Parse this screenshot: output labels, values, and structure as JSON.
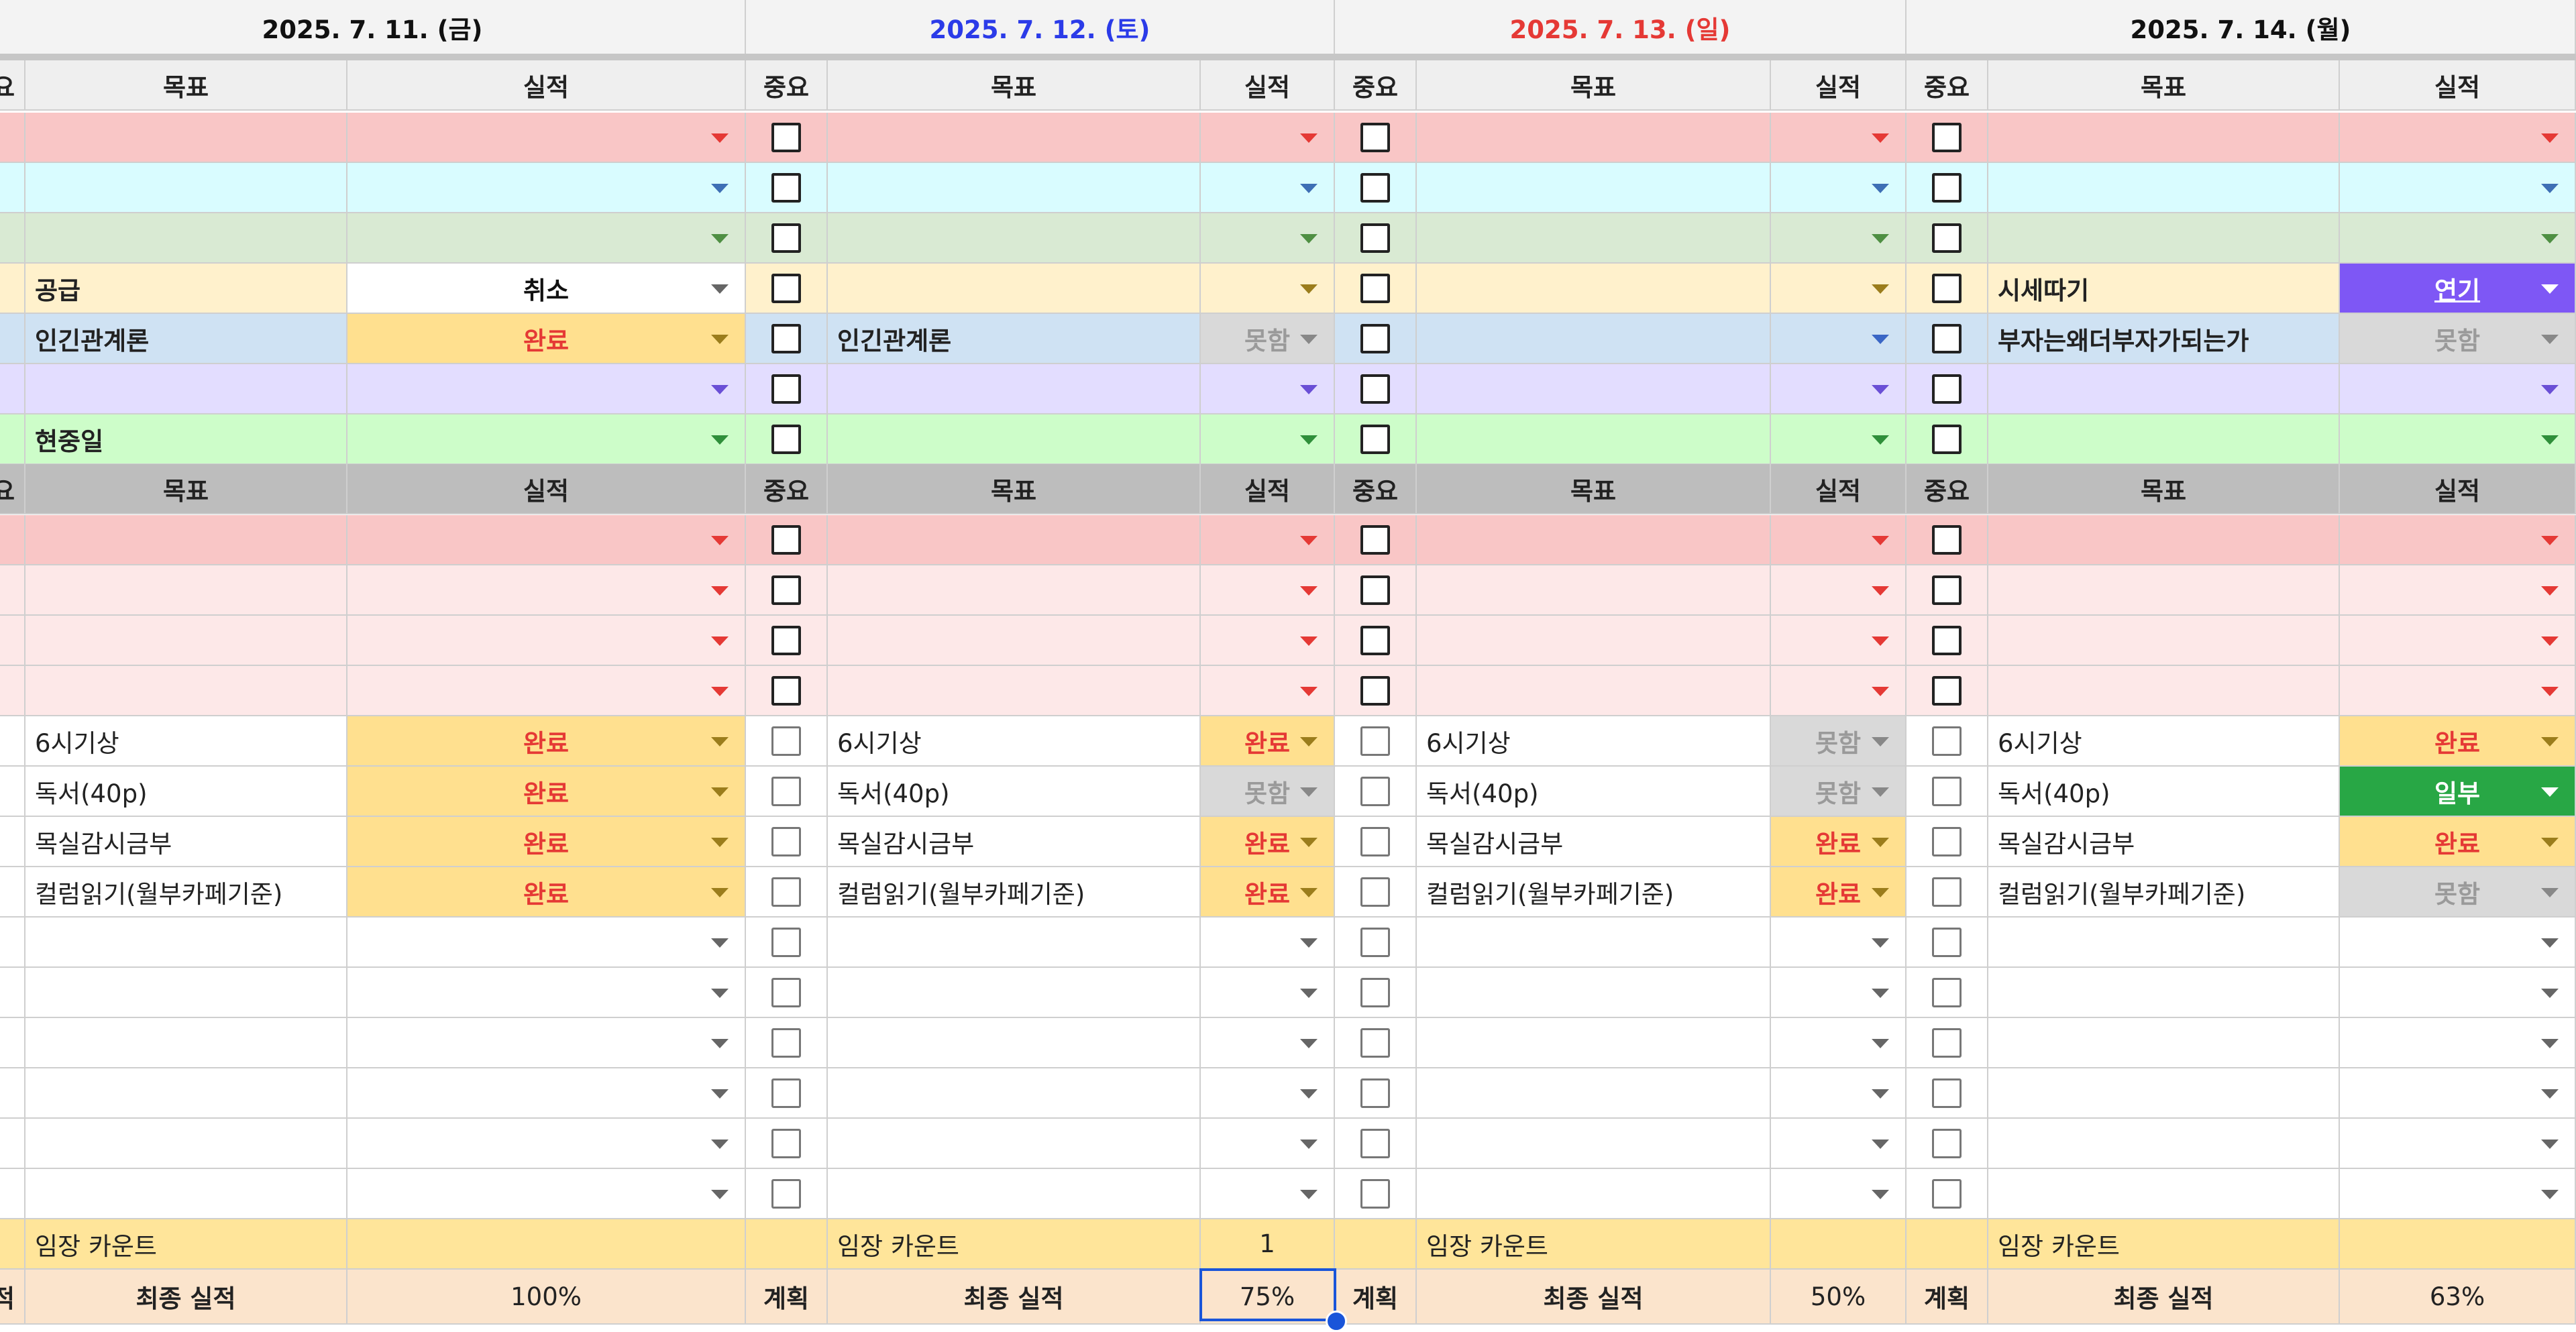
{
  "dates": [
    {
      "label": "2025. 7. 11. (금)",
      "color": "#111111"
    },
    {
      "label": "2025. 7. 12. (토)",
      "color": "#2b3be8"
    },
    {
      "label": "2025. 7. 13. (일)",
      "color": "#e53935"
    },
    {
      "label": "2025. 7. 14. (월)",
      "color": "#111111"
    }
  ],
  "headers": {
    "goal": "목표",
    "result": "실적",
    "important": "중요",
    "edge_partial": "요"
  },
  "top_rows": [
    {
      "bg": "#f9c6c6",
      "caret": "#e53935",
      "cells": [
        {
          "goal": "",
          "result": ""
        },
        {
          "goal": "",
          "result": ""
        },
        {
          "goal": "",
          "result": ""
        },
        {
          "goal": "",
          "result": ""
        }
      ]
    },
    {
      "bg": "#d9fcff",
      "caret": "#3e6fb5",
      "cells": [
        {
          "goal": "",
          "result": ""
        },
        {
          "goal": "",
          "result": ""
        },
        {
          "goal": "",
          "result": ""
        },
        {
          "goal": "",
          "result": ""
        }
      ]
    },
    {
      "bg": "#d9ead3",
      "caret": "#4f8f43",
      "cells": [
        {
          "goal": "",
          "result": ""
        },
        {
          "goal": "",
          "result": ""
        },
        {
          "goal": "",
          "result": ""
        },
        {
          "goal": "",
          "result": ""
        }
      ]
    },
    {
      "bg": "#fff1cc",
      "caret": "#9b7d1c",
      "cells": [
        {
          "goal": "공급",
          "result": "취소",
          "result_style": "cancel"
        },
        {
          "goal": "",
          "result": ""
        },
        {
          "goal": "",
          "result": ""
        },
        {
          "goal": "시세따기",
          "result": "연기",
          "result_style": "delay"
        }
      ]
    },
    {
      "bg": "#cfe2f3",
      "caret": "#3a66c5",
      "cells": [
        {
          "goal": "인긴관계론",
          "result": "완료",
          "result_style": "done"
        },
        {
          "goal": "인긴관계론",
          "result": "못함",
          "result_style": "fail"
        },
        {
          "goal": "",
          "result": ""
        },
        {
          "goal": "부자는왜더부자가되는가",
          "result": "못함",
          "result_style": "fail"
        }
      ]
    },
    {
      "bg": "#e3ddff",
      "caret": "#6a4fd6",
      "cells": [
        {
          "goal": "",
          "result": ""
        },
        {
          "goal": "",
          "result": ""
        },
        {
          "goal": "",
          "result": ""
        },
        {
          "goal": "",
          "result": ""
        }
      ]
    },
    {
      "bg": "#cdfdc9",
      "caret": "#2f8f3a",
      "cells": [
        {
          "goal": "현중일",
          "result": ""
        },
        {
          "goal": "",
          "result": ""
        },
        {
          "goal": "",
          "result": ""
        },
        {
          "goal": "",
          "result": ""
        }
      ]
    }
  ],
  "bottom_pink_rows": 4,
  "routines": [
    {
      "cells": [
        {
          "goal": "6시기상",
          "result": "완료",
          "result_style": "done"
        },
        {
          "goal": "6시기상",
          "result": "완료",
          "result_style": "done"
        },
        {
          "goal": "6시기상",
          "result": "못함",
          "result_style": "fail"
        },
        {
          "goal": "6시기상",
          "result": "완료",
          "result_style": "done"
        }
      ]
    },
    {
      "cells": [
        {
          "goal": "독서(40p)",
          "result": "완료",
          "result_style": "done"
        },
        {
          "goal": "독서(40p)",
          "result": "못함",
          "result_style": "fail"
        },
        {
          "goal": "독서(40p)",
          "result": "못함",
          "result_style": "fail"
        },
        {
          "goal": "독서(40p)",
          "result": "일부",
          "result_style": "partial"
        }
      ]
    },
    {
      "cells": [
        {
          "goal": "목실감시금부",
          "result": "완료",
          "result_style": "done"
        },
        {
          "goal": "목실감시금부",
          "result": "완료",
          "result_style": "done"
        },
        {
          "goal": "목실감시금부",
          "result": "완료",
          "result_style": "done"
        },
        {
          "goal": "목실감시금부",
          "result": "완료",
          "result_style": "done"
        }
      ]
    },
    {
      "cells": [
        {
          "goal": "컬럼읽기(월부카페기준)",
          "result": "완료",
          "result_style": "done"
        },
        {
          "goal": "컬럼읽기(월부카페기준)",
          "result": "완료",
          "result_style": "done"
        },
        {
          "goal": "컬럼읽기(월부카페기준)",
          "result": "완료",
          "result_style": "done"
        },
        {
          "goal": "컬럼읽기(월부카페기준)",
          "result": "못함",
          "result_style": "fail"
        }
      ]
    }
  ],
  "empty_rows": 6,
  "footer": {
    "count_label": "임장 카운트",
    "counts": [
      "",
      "1",
      "",
      ""
    ],
    "final_label": "최종 실적",
    "plan_label": "계획",
    "edge_final": "적",
    "finals": [
      "100%",
      "75%",
      "50%",
      "63%"
    ]
  },
  "colors": {
    "date_row_bg": "#f3f3f3",
    "header_bg": "#efefef",
    "header2_bg": "#bdbdbd",
    "pink_strong": "#f9c6c6",
    "pink_light": "#fde8e8",
    "footer_count_bg": "#ffe59a",
    "footer_final_bg": "#fbe4cc",
    "done_bg": "#ffe08f",
    "done_fg": "#e53935",
    "fail_bg": "#d9d9d9",
    "fail_fg": "#9a9a9a",
    "partial_bg": "#28a745",
    "partial_fg": "#ffffff",
    "delay_bg": "#7e57f5",
    "delay_fg": "#ffffff",
    "cancel_bg": "#ffffff",
    "cancel_fg": "#111111",
    "selection": "#1a55d9"
  },
  "icons": {
    "dropdown": "dropdown-caret-icon",
    "checkbox": "checkbox-icon"
  }
}
